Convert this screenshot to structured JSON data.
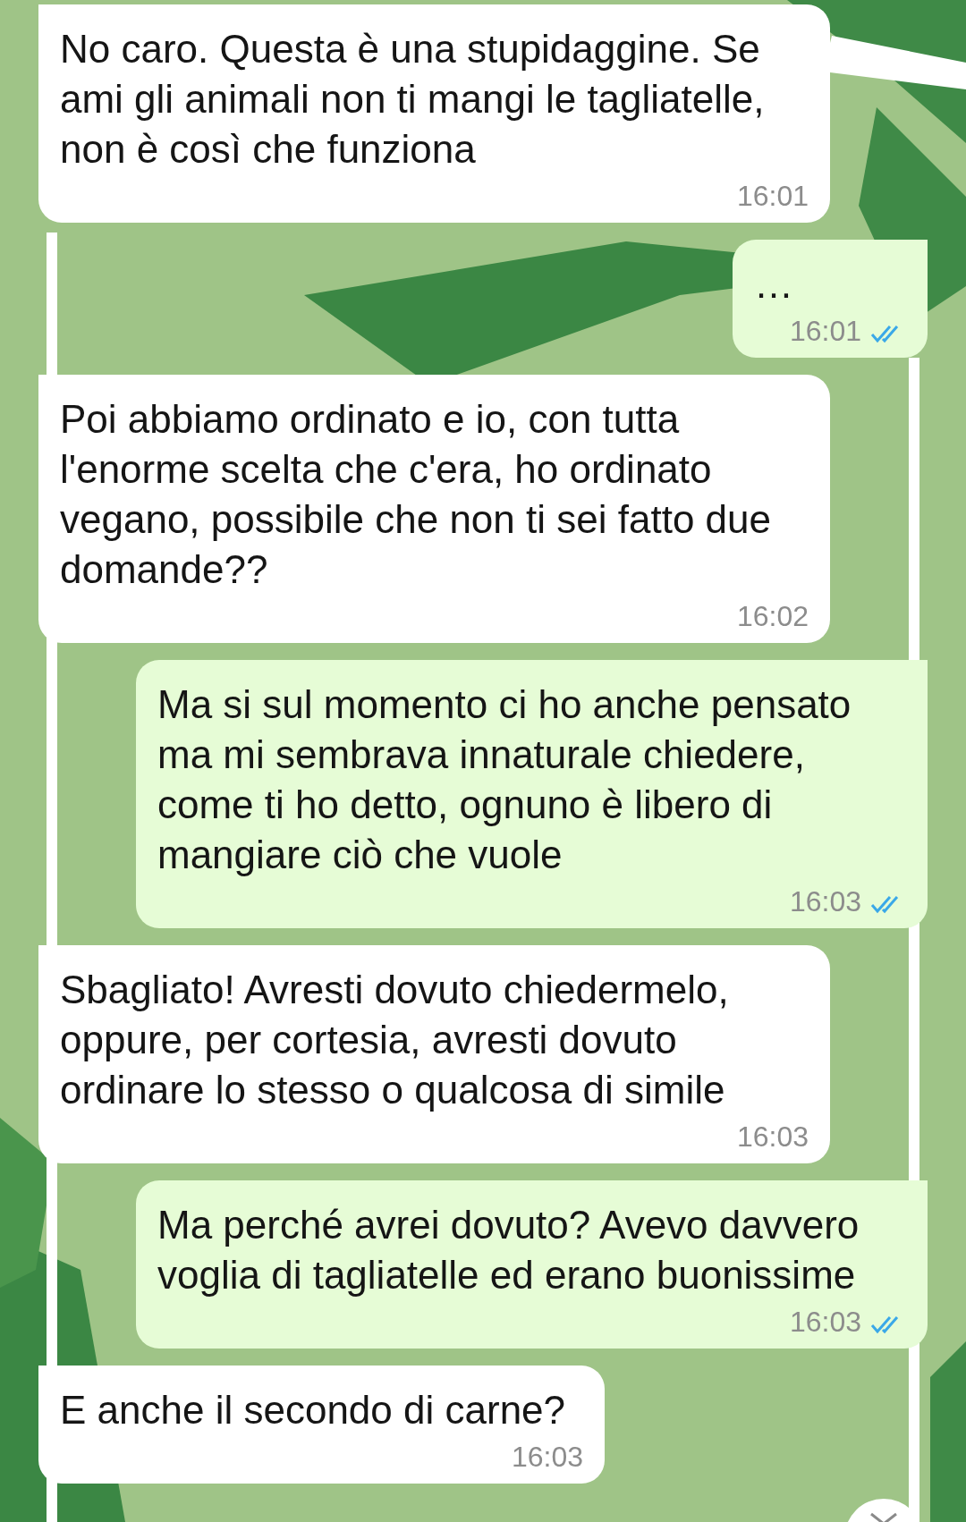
{
  "messages": [
    {
      "kind": "in",
      "text": "No caro. Questa è una stupidaggine. Se ami gli animali non ti mangi le tagliatelle, non è così che funziona",
      "time": "16:01"
    },
    {
      "kind": "out",
      "text": "…",
      "time": "16:01",
      "read": true
    },
    {
      "kind": "in",
      "text": "Poi abbiamo ordinato e io, con tutta l'enorme scelta che c'era, ho ordinato vegano, possibile che non ti sei fatto due domande??",
      "time": "16:02"
    },
    {
      "kind": "out",
      "text": "Ma si sul momento ci ho anche pensato ma mi sembrava innaturale chiedere, come ti ho detto, ognuno è libero di mangiare ciò che vuole",
      "time": "16:03",
      "read": true
    },
    {
      "kind": "in",
      "text": "Sbagliato! Avresti dovuto chiedermelo, oppure, per cortesia, avresti dovuto ordinare lo stesso o qualcosa di simile",
      "time": "16:03"
    },
    {
      "kind": "out",
      "text": "Ma perché avrei dovuto? Avevo davvero voglia di tagliatelle ed erano buonissime",
      "time": "16:03",
      "read": true
    },
    {
      "kind": "in",
      "text": "E anche il secondo di carne?",
      "time": "16:03"
    }
  ]
}
